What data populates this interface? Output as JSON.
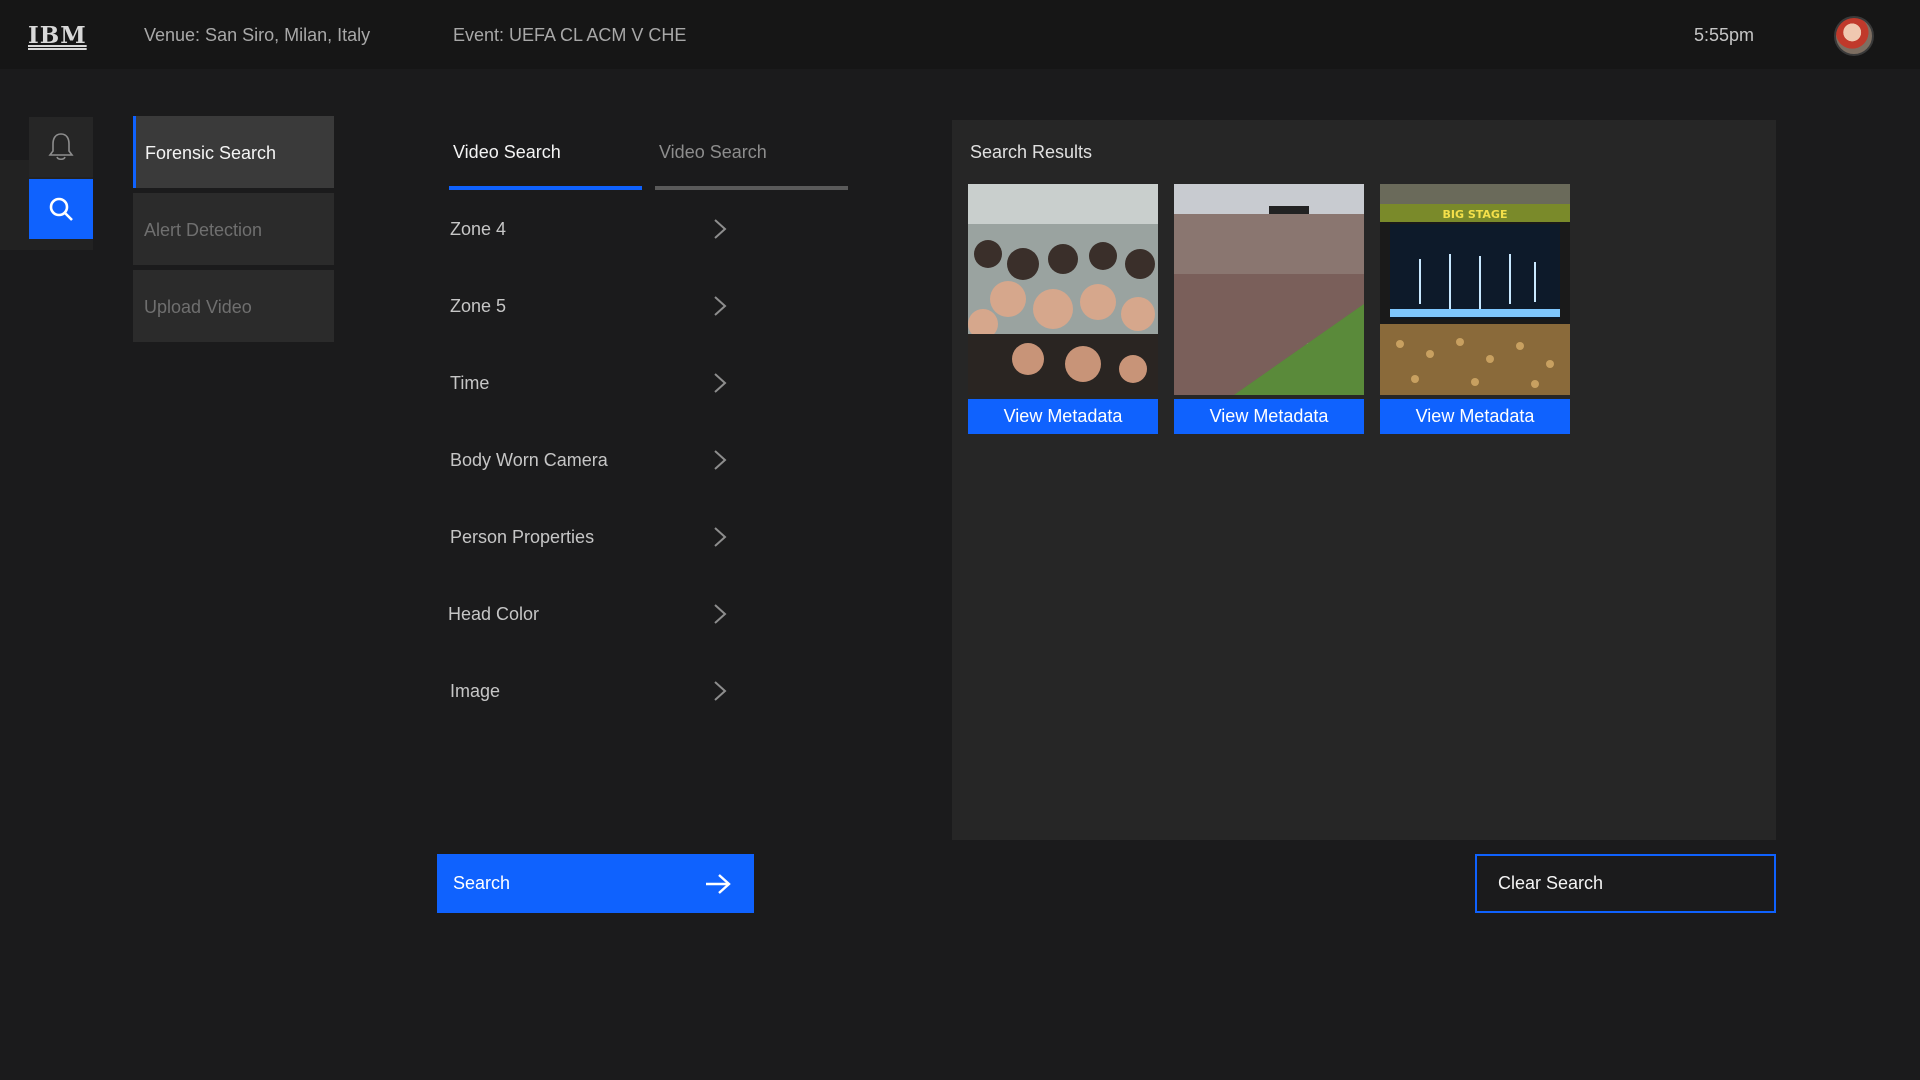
{
  "header": {
    "logo": "IBM",
    "venue": "Venue: San Siro, Milan, Italy",
    "event": "Event: UEFA CL ACM V CHE",
    "time": "5:55pm"
  },
  "sidebar_icons": [
    "bell-icon",
    "search-icon"
  ],
  "menu": [
    {
      "label": "Forensic Search",
      "active": true
    },
    {
      "label": "Alert Detection",
      "active": false
    },
    {
      "label": "Upload Video",
      "active": false
    }
  ],
  "tabs": [
    {
      "label": "Video Search",
      "active": true
    },
    {
      "label": "Video Search",
      "active": false
    }
  ],
  "filters": [
    "Zone 4",
    "Zone 5",
    "Time",
    "Body Worn Camera",
    "Person Properties",
    "Head Color",
    "Image"
  ],
  "search_button": {
    "label": "Search"
  },
  "results": {
    "title": "Search Results",
    "items": [
      {
        "button": "View Metadata"
      },
      {
        "button": "View Metadata"
      },
      {
        "button": "View Metadata",
        "banner": "BIG STAGE"
      }
    ]
  },
  "clear_button": {
    "label": "Clear Search"
  },
  "colors": {
    "accent": "#0f62fe",
    "background": "#1b1b1c",
    "panel": "#262626"
  }
}
